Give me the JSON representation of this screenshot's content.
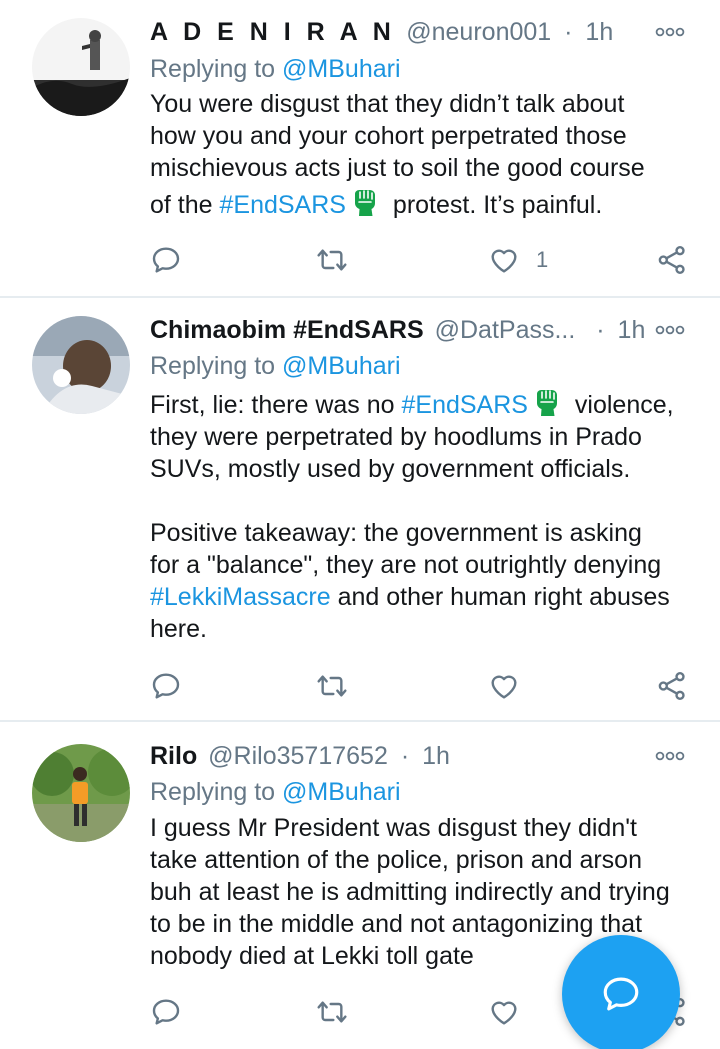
{
  "tweets": [
    {
      "name": "A D E N I R A N",
      "handle": "@neuron001",
      "dot": "·",
      "time": "1h",
      "replying_label": "Replying to ",
      "replying_to": "@MBuhari",
      "lines": [
        "You were disgust that they didn’t talk about",
        "how you and your cohort perpetrated those",
        "mischievous acts just to soil the good course"
      ],
      "line4_pre": "of the ",
      "line4_tag": "#EndSARS",
      "line4_post": " protest. It’s painful.",
      "like_count": "1"
    },
    {
      "name": "Chimaobim #EndSARS",
      "handle": "@DatPass...",
      "dot": "·",
      "time": "1h",
      "replying_label": "Replying to ",
      "replying_to": "@MBuhari",
      "line1_pre": "First, lie: there was no ",
      "line1_tag": "#EndSARS",
      "line1_post": " violence,",
      "lines": [
        "they were perpetrated by hoodlums in Prado",
        "SUVs, mostly used by government officials."
      ],
      "para2_lines": [
        "Positive takeaway: the government is asking",
        "for a \"balance\", they are not outrightly denying"
      ],
      "para2_tag": "#LekkiMassacre",
      "para2_post": " and other human right abuses",
      "para2_last": "here."
    },
    {
      "name": "Rilo",
      "handle": "@Rilo35717652",
      "dot": "·",
      "time": "1h",
      "replying_label": "Replying to ",
      "replying_to": "@MBuhari",
      "lines": [
        "I guess Mr President was disgust they didn't",
        "take attention of the police, prison and arson",
        "buh at least he is admitting indirectly and trying",
        "to be in the middle and not antagonizing that",
        "nobody died at Lekki toll gate"
      ]
    }
  ],
  "icons": {
    "reply": "reply-icon",
    "retweet": "retweet-icon",
    "like": "heart-icon",
    "share": "share-icon",
    "more": "more-icon",
    "compose": "compose-reply-icon",
    "hashtag_emoji": "endsars-fist-icon"
  },
  "colors": {
    "link": "#1b95e0",
    "muted": "#657786",
    "text": "#14171a",
    "divider": "#e6ecf0",
    "fab": "#1da1f2",
    "emoji_green": "#16a34a"
  }
}
